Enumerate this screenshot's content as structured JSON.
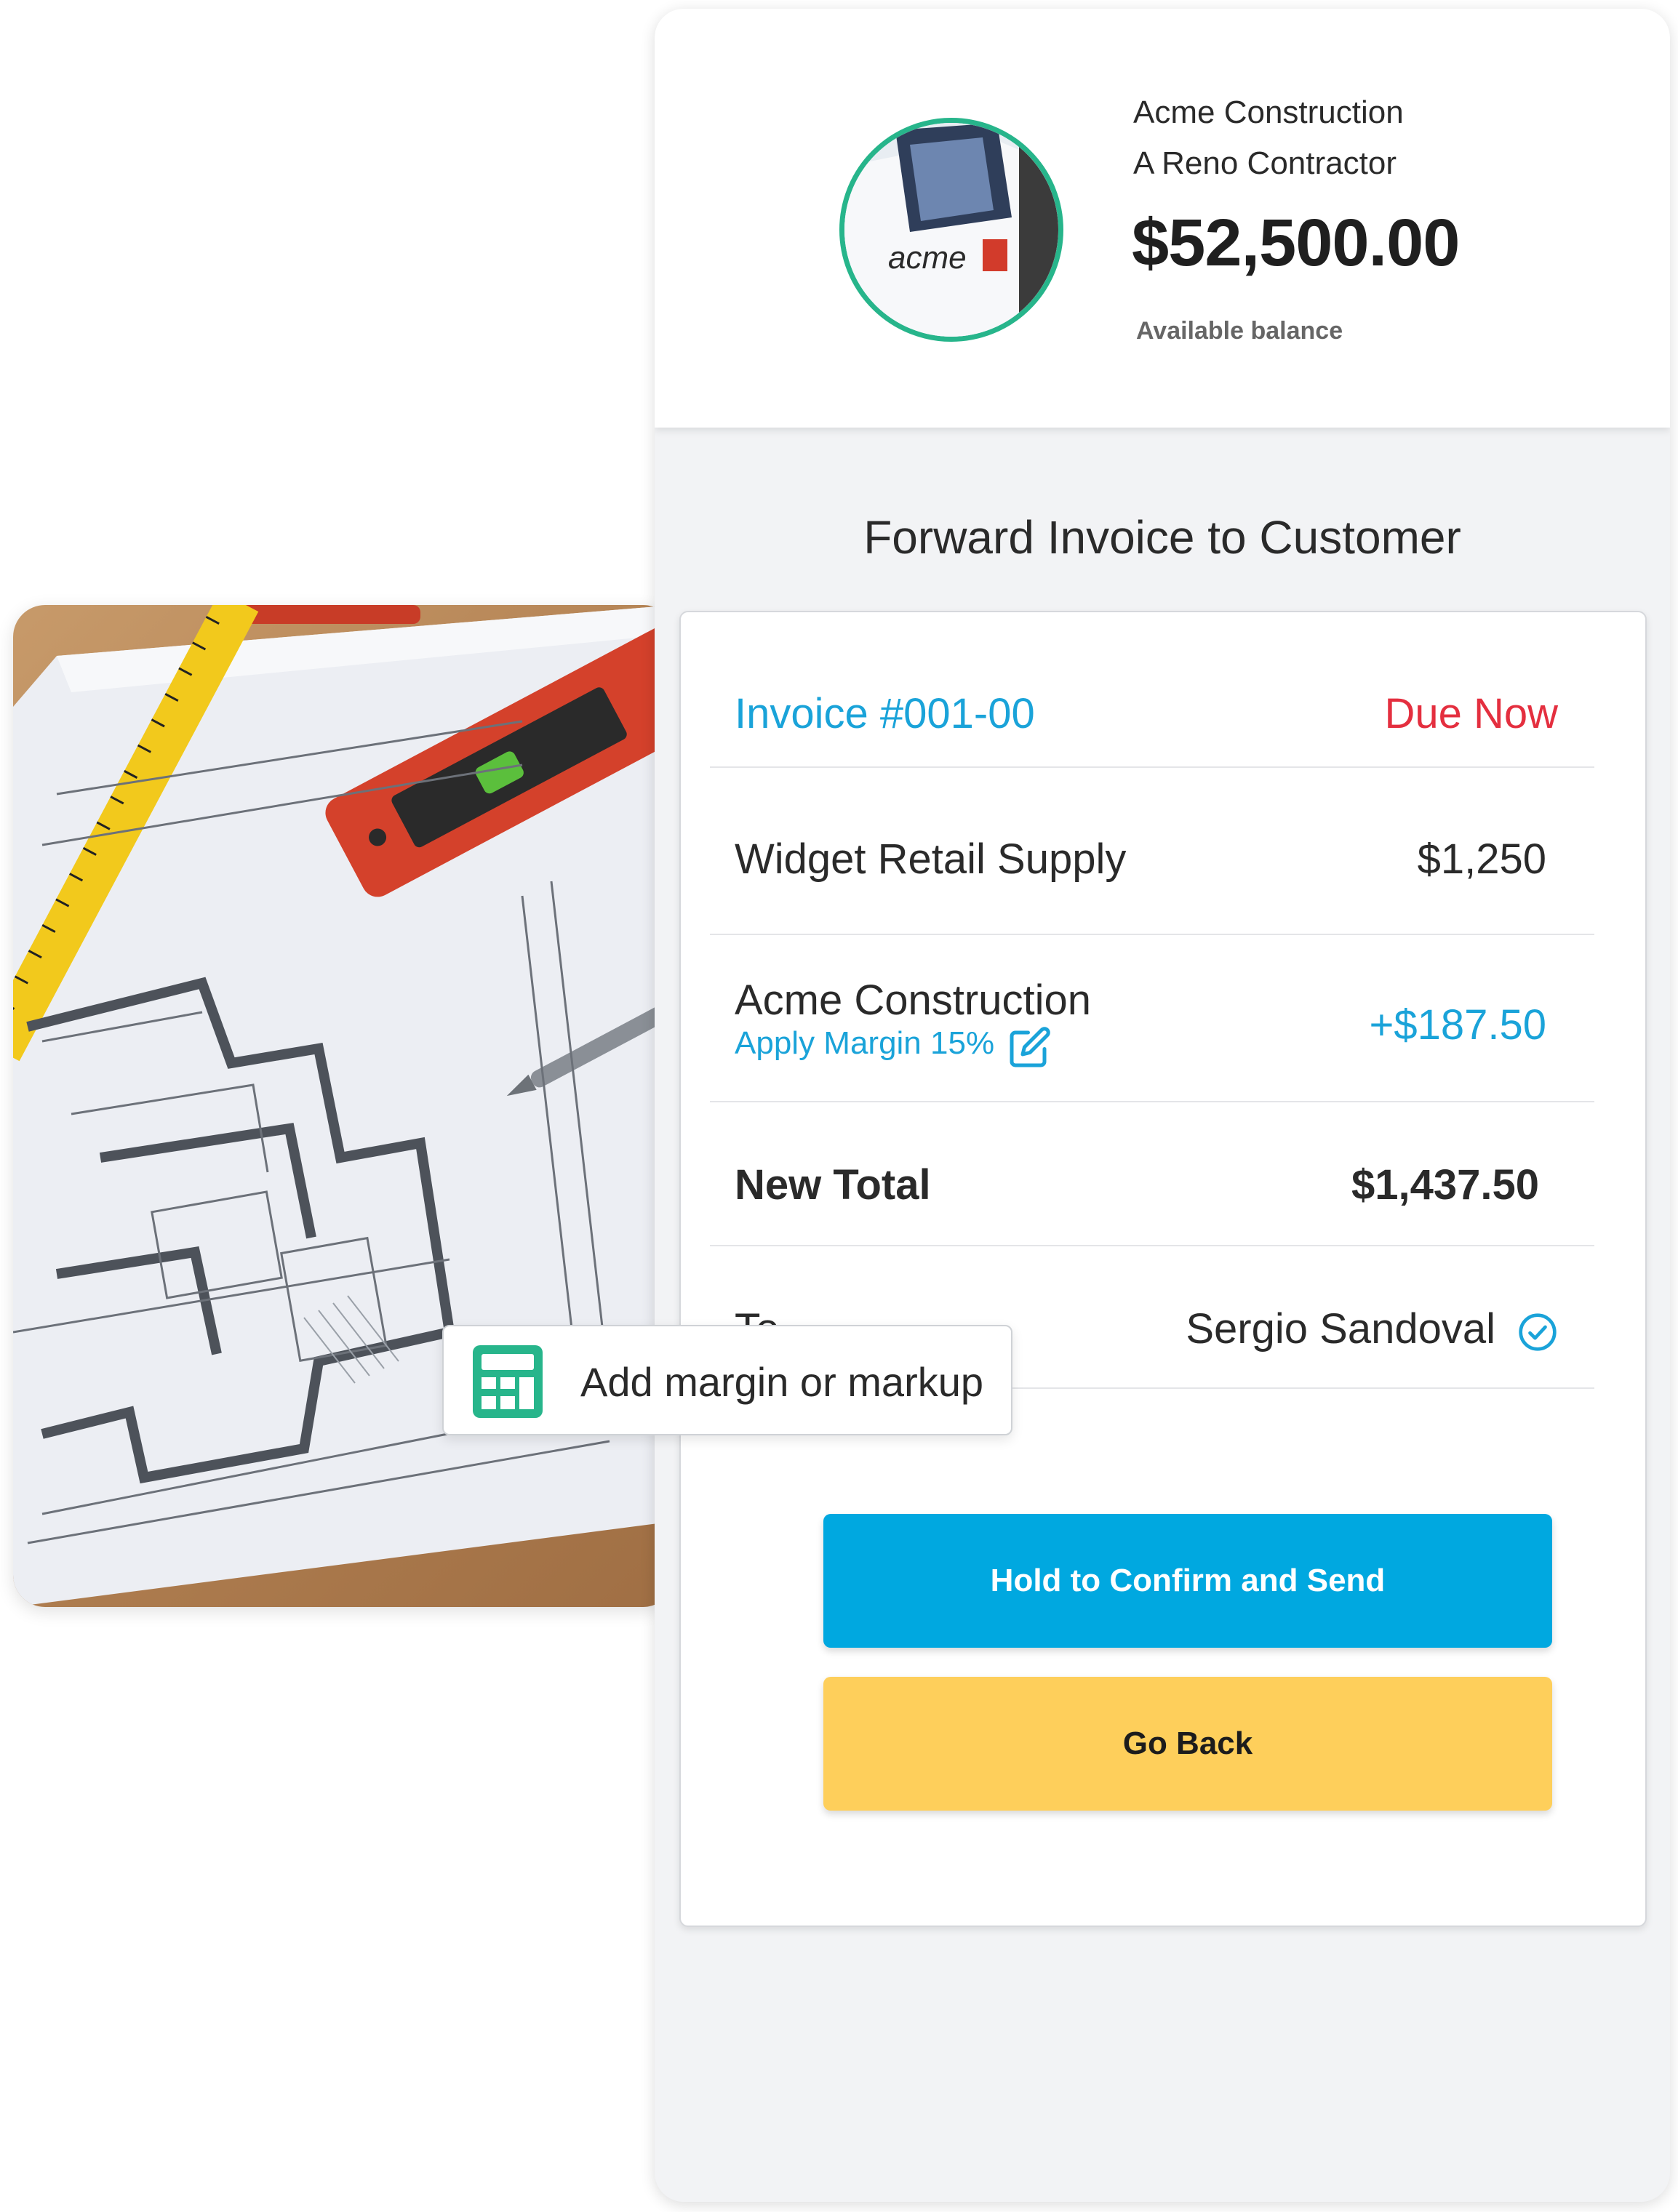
{
  "company": {
    "name": "Acme Construction",
    "subtitle": "A Reno Contractor",
    "balance": "$52,500.00",
    "balance_label": "Available balance",
    "avatar_text": "acme"
  },
  "panel": {
    "title": "Forward Invoice to Customer"
  },
  "invoice": {
    "number": "Invoice #001-00",
    "status": "Due Now",
    "line_items": [
      {
        "label": "Widget Retail Supply",
        "value": "$1,250"
      },
      {
        "label": "Acme Construction",
        "value": "+$187.50",
        "link": "Apply Margin 15%"
      }
    ],
    "total_label": "New Total",
    "total_value": "$1,437.50",
    "to_label": "To",
    "recipient": "Sergio Sandoval"
  },
  "actions": {
    "confirm_label": "Hold to Confirm and Send",
    "back_label": "Go Back"
  },
  "tag": {
    "label": "Add margin or markup"
  },
  "colors": {
    "accent_blue": "#00a8e0",
    "link_blue": "#1aa3d9",
    "due_red": "#e42f3f",
    "button_yellow": "#fecf5b",
    "avatar_ring_green": "#27b58b",
    "calculator_green": "#27b58b"
  },
  "icons": {
    "edit": "edit-pencil-icon",
    "verified": "check-circle-icon",
    "calculator": "calculator-icon"
  }
}
